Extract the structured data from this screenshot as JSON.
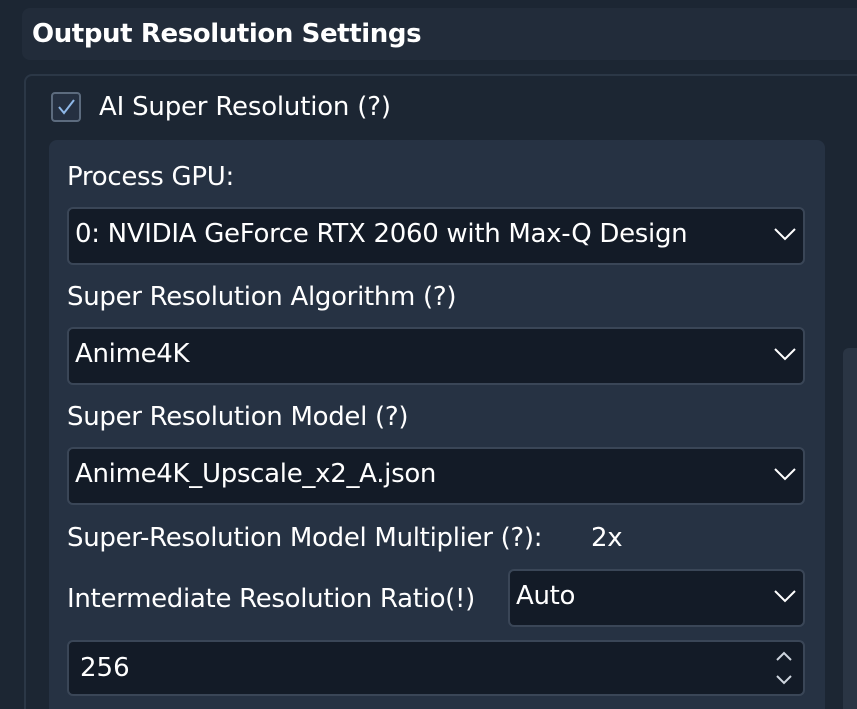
{
  "section": {
    "title": "Output Resolution Settings"
  },
  "ai_super_resolution": {
    "label": "AI Super Resolution (?)",
    "checked": true
  },
  "gpu": {
    "label": "Process GPU:",
    "value": "0: NVIDIA GeForce RTX 2060 with Max-Q Design"
  },
  "algorithm": {
    "label": "Super Resolution Algorithm (?)",
    "value": "Anime4K"
  },
  "model": {
    "label": "Super Resolution Model (?)",
    "value": "Anime4K_Upscale_x2_A.json"
  },
  "multiplier": {
    "label": "Super-Resolution Model Multiplier (?):",
    "value": "2x"
  },
  "intermediate": {
    "label": "Intermediate Resolution Ratio(!)",
    "value": "Auto"
  },
  "spinbox": {
    "value": "256"
  },
  "colors": {
    "background": "#1c2633",
    "panel": "#263243",
    "field": "#131b27",
    "checkmark": "#8fb8e8"
  }
}
